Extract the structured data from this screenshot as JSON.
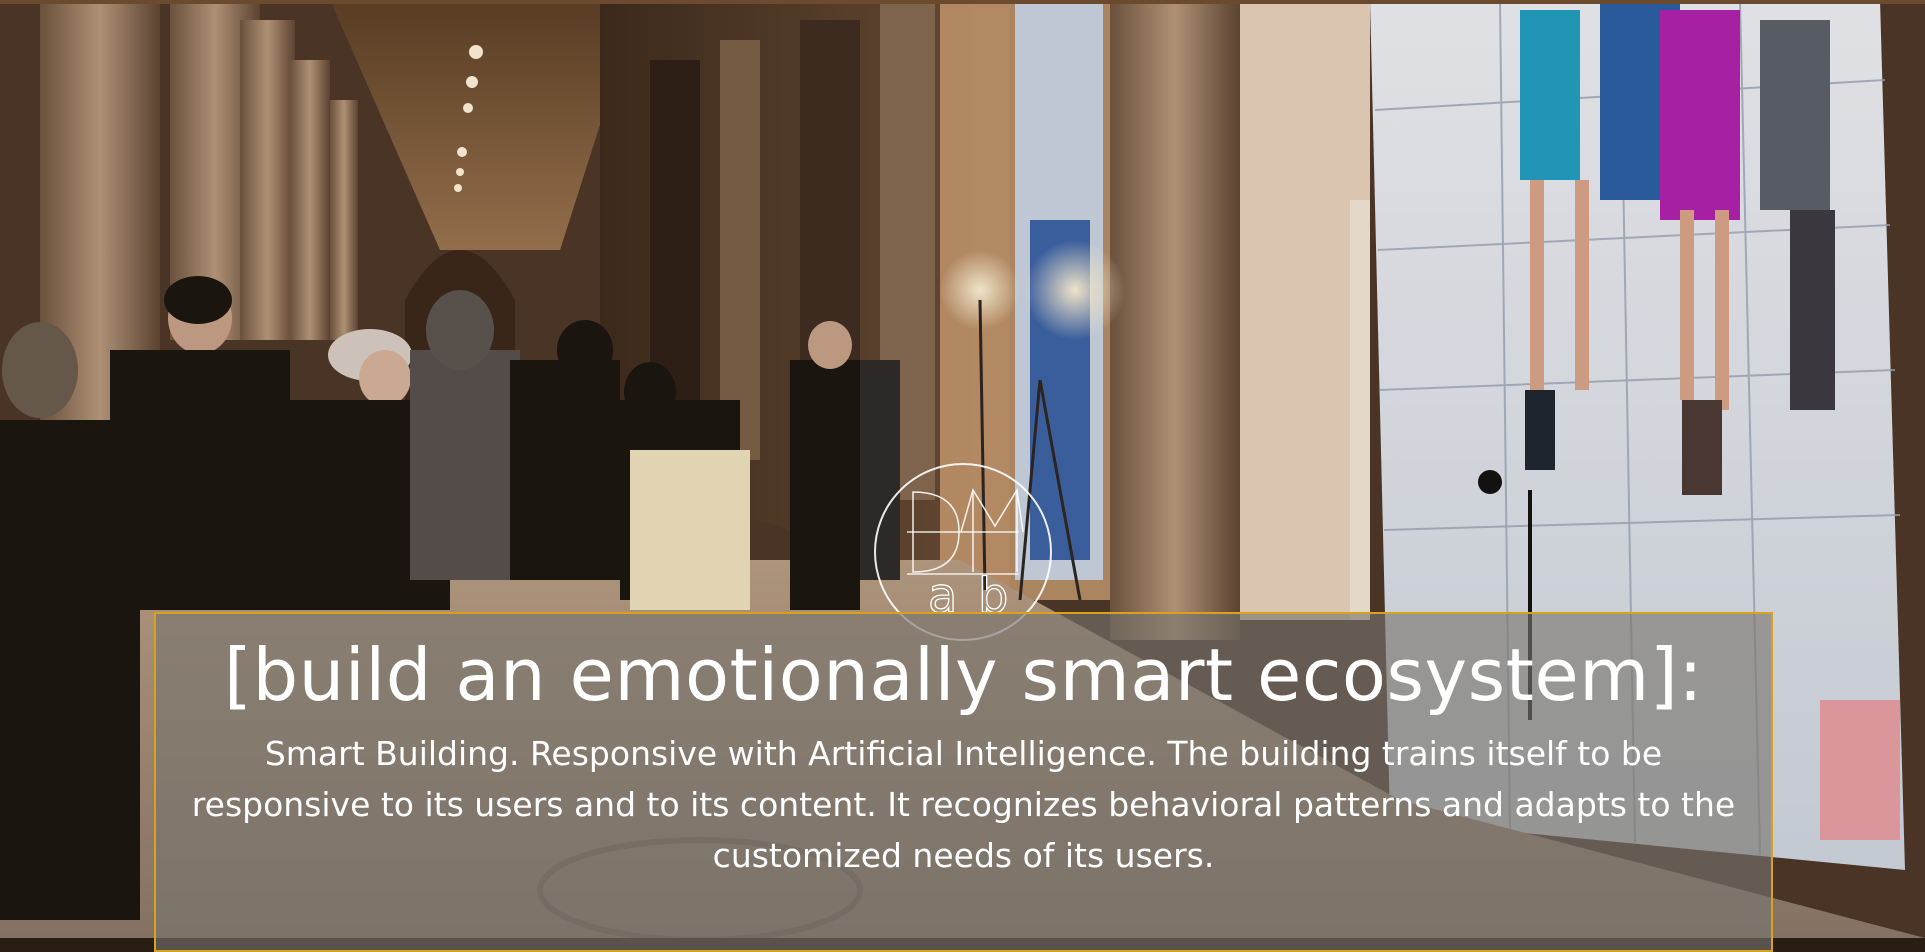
{
  "slide": {
    "logo": {
      "letters": [
        "D",
        "M",
        "L",
        "a",
        "b"
      ],
      "color": "#ffffff"
    },
    "headline": "[build an emotionally smart ecosystem]:",
    "body": "Smart Building. Responsive with Artificial Intelligence. The building trains itself to be responsive to its users and to its content. It recognizes behavioral patterns and adapts to the customized needs of its users.",
    "colors": {
      "panel_border": "#d8a21c",
      "panel_fill": "rgba(120,116,110,0.62)",
      "text": "#ffffff"
    }
  }
}
